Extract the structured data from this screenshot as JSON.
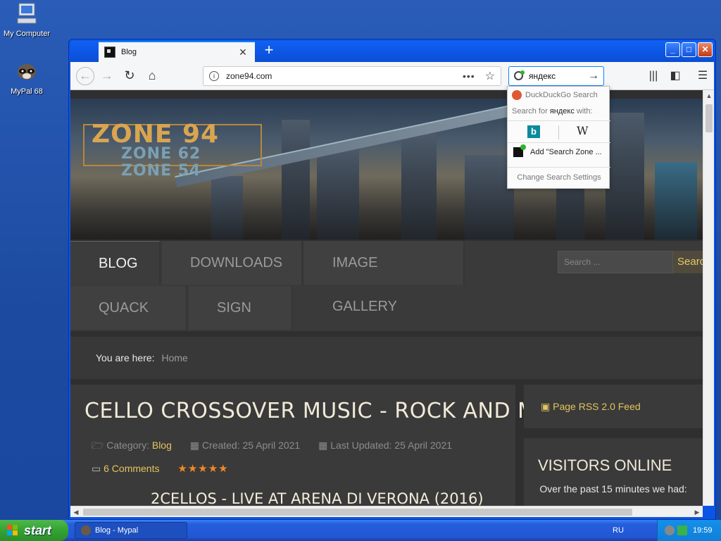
{
  "desktop": {
    "icons": [
      {
        "label": "My Computer"
      },
      {
        "label": "MyPal 68"
      }
    ]
  },
  "browser": {
    "tab": {
      "title": "Blog"
    },
    "url": "zone94.com",
    "search": {
      "query": "яндекс"
    }
  },
  "search_dropdown": {
    "engine": "DuckDuckGo Search",
    "search_for_prefix": "Search for",
    "search_for_query": "яндекс",
    "search_for_suffix": "with:",
    "add_engine": "Add \"Search Zone ...",
    "settings": "Change Search Settings"
  },
  "site": {
    "logo": {
      "main": "ZONE 94",
      "sub1": "ZONE 62",
      "sub2": "ZONE 54"
    },
    "menu": {
      "blog": "BLOG",
      "downloads": "DOWNLOADS",
      "gallery": "IMAGE GALLERY",
      "quack": "QUACK IT",
      "signin": "SIGN IN"
    },
    "search_placeholder": "Search ...",
    "search_button": "Search",
    "breadcrumb": {
      "label": "You are here:",
      "home": "Home"
    },
    "article": {
      "title": "CELLO CROSSOVER MUSIC - ROCK AND METAL",
      "category_label": "Category:",
      "category": "Blog",
      "created": "Created: 25 April 2021",
      "updated": "Last Updated: 25 April 2021",
      "comments": "6 Comments",
      "rating_stars": 5,
      "video_title": "2CELLOS - LIVE AT ARENA DI VERONA (2016)"
    },
    "sidebar": {
      "rss": "Page RSS 2.0 Feed",
      "visitors_title": "VISITORS ONLINE",
      "visitors_text": "Over the past 15 minutes we had:"
    }
  },
  "taskbar": {
    "start": "start",
    "task": "Blog - Mypal",
    "language": "RU",
    "clock": "19:59"
  },
  "colors": {
    "accent": "#e4c45e",
    "xp_blue": "#0b55e4",
    "start_green": "#33a331"
  }
}
